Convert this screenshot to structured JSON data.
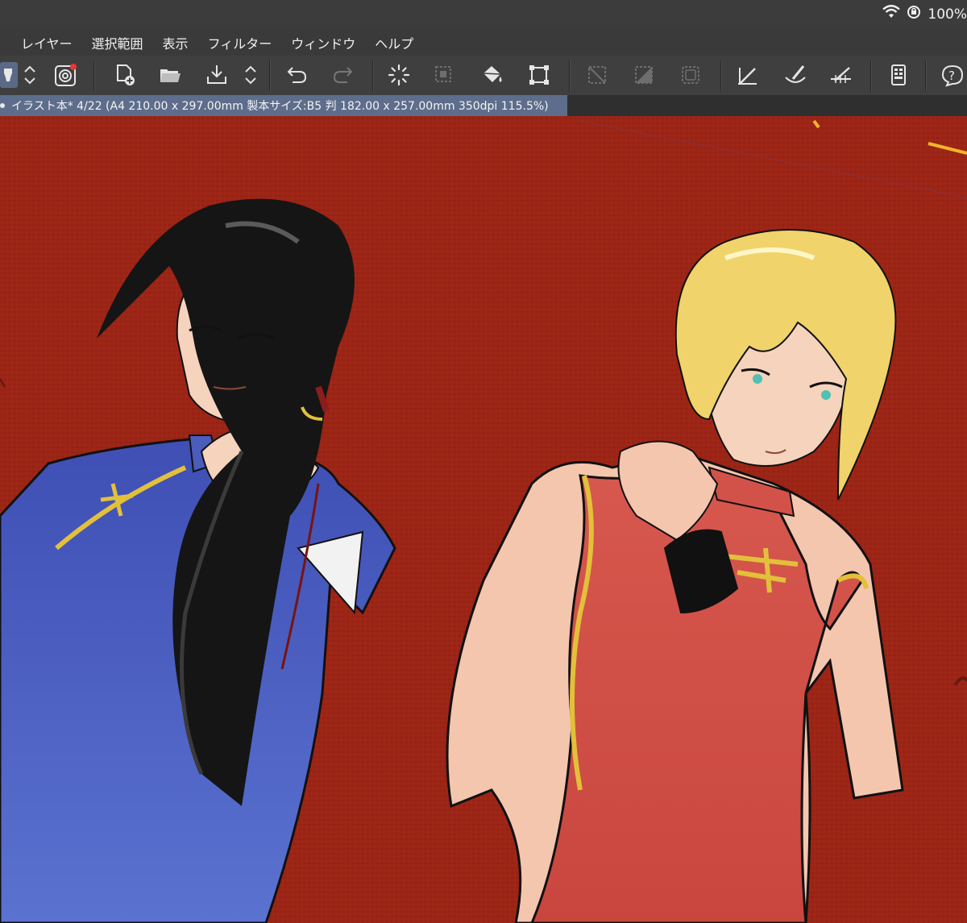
{
  "statusbar": {
    "battery_text": "100%",
    "icons": [
      "wifi-icon",
      "orientation-lock-icon"
    ]
  },
  "menubar": {
    "items": [
      {
        "label": "レイヤー"
      },
      {
        "label": "選択範囲"
      },
      {
        "label": "表示"
      },
      {
        "label": "フィルター"
      },
      {
        "label": "ウィンドウ"
      },
      {
        "label": "ヘルプ"
      }
    ]
  },
  "toolbar": {
    "buttons": [
      "brush-tool-icon",
      "chevron-updown-icon",
      "quick-access-icon",
      "new-file-icon",
      "open-folder-icon",
      "save-download-icon",
      "chevron-updown-icon",
      "undo-icon",
      "redo-icon",
      "loading-spinner-icon",
      "select-area-icon",
      "fill-bucket-icon",
      "transform-icon",
      "clear-selection-icon",
      "invert-selection-icon",
      "selection-outline-icon",
      "snap-ruler-icon",
      "snap-brush-icon",
      "snap-grid-icon",
      "command-bar-icon",
      "help-icon"
    ]
  },
  "tab": {
    "title": "イラスト本* 4/22 (A4 210.00 x 297.00mm 製本サイズ:B5 判 182.00 x 257.00mm 350dpi 115.5%)"
  },
  "colors": {
    "canvas_bg": "#9c2516",
    "robe_blue": "#4b5fbe",
    "robe_red": "#d2524a",
    "trim_gold": "#e2c03a",
    "hair_black": "#151515",
    "hair_blond": "#f0d36a",
    "skin": "#f6d3bd",
    "tab_active": "#5d6d8b"
  }
}
